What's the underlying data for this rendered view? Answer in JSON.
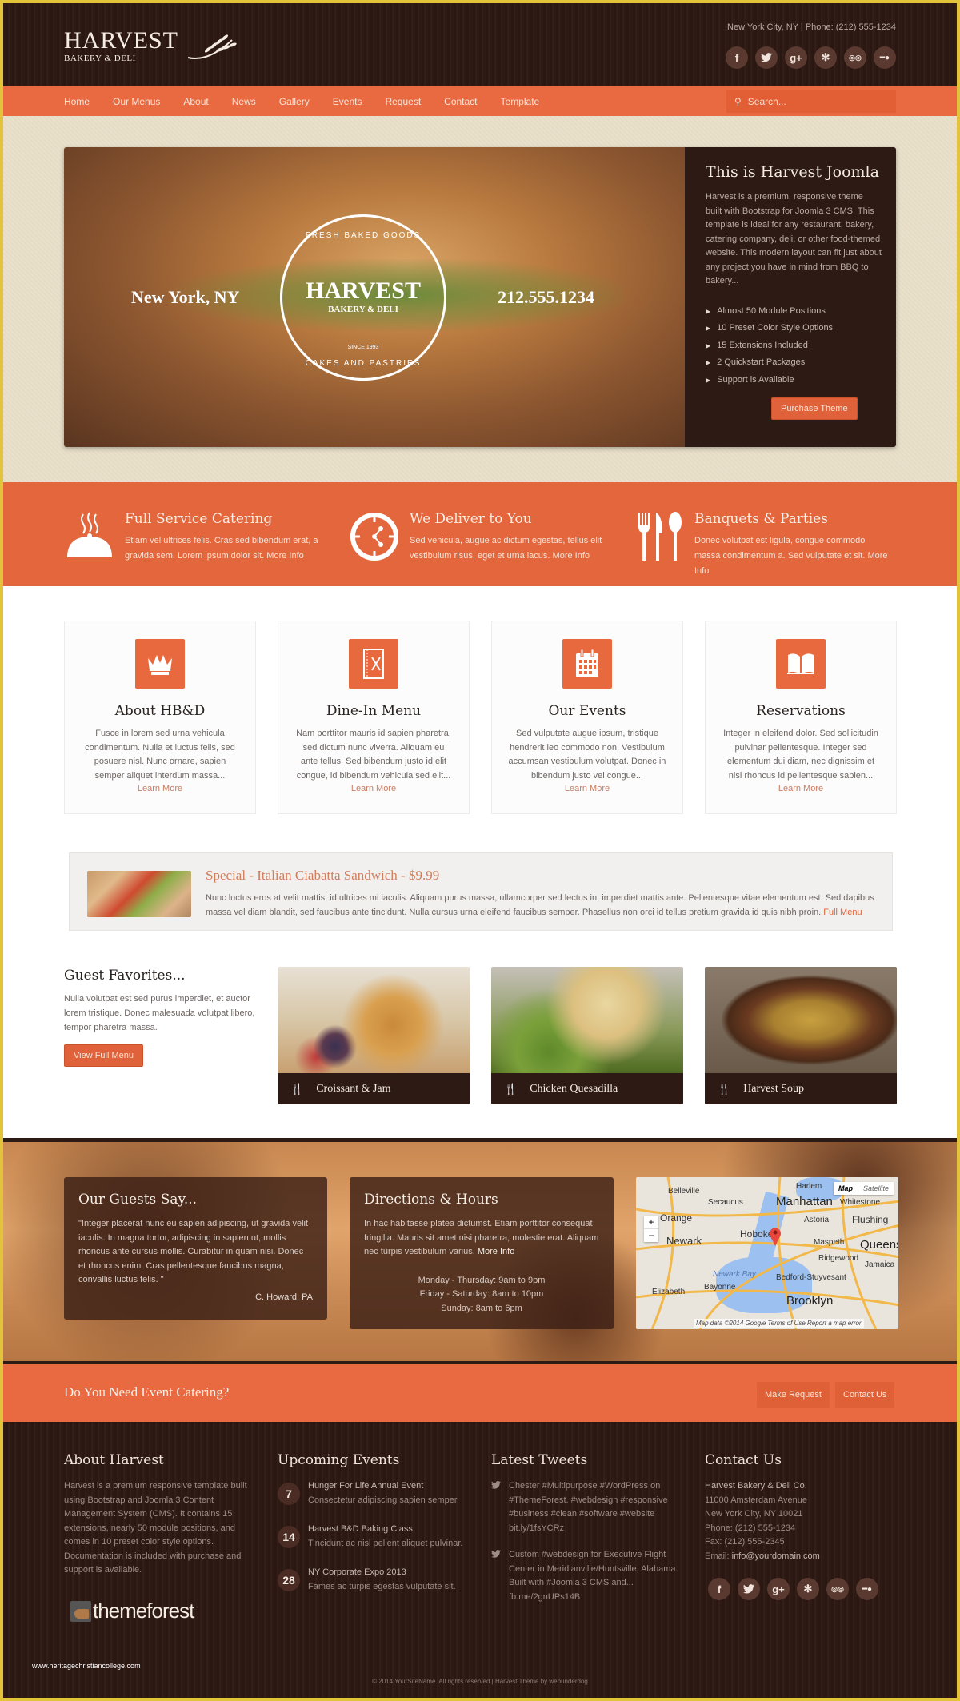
{
  "header": {
    "logo_main": "HARVEST",
    "logo_sub": "BAKERY & DELI",
    "top_info": "New York City, NY  |  Phone: (212) 555-1234",
    "socials": [
      {
        "name": "facebook-icon",
        "glyph": "f"
      },
      {
        "name": "twitter-icon",
        "glyph": "🐦"
      },
      {
        "name": "google-plus-icon",
        "glyph": "g+"
      },
      {
        "name": "yelp-icon",
        "glyph": "✻"
      },
      {
        "name": "tripadvisor-icon",
        "glyph": "◎◎"
      },
      {
        "name": "urbanspoon-icon",
        "glyph": "━●"
      }
    ]
  },
  "nav": {
    "items": [
      "Home",
      "Our Menus",
      "About",
      "News",
      "Gallery",
      "Events",
      "Request",
      "Contact",
      "Template"
    ],
    "search_placeholder": "Search..."
  },
  "hero": {
    "location": "New York, NY",
    "phone": "212.555.1234",
    "badge": {
      "top": "FRESH BAKED GOODS",
      "name": "HARVEST",
      "sub": "BAKERY & DELI",
      "since": "SINCE 1993",
      "bottom": "CAKES AND PASTRIES"
    },
    "panel": {
      "title": "This is Harvest Joomla",
      "body": "Harvest is a premium, responsive theme built with Bootstrap for Joomla 3 CMS. This template is ideal for any restaurant, bakery, catering company, deli, or other food-themed website. This modern layout can fit just about any project you have in mind from BBQ to bakery...",
      "features": [
        "Almost 50 Module Positions",
        "10 Preset Color Style Options",
        "15 Extensions Included",
        "2 Quickstart Packages",
        "Support is Available"
      ],
      "button": "Purchase Theme"
    }
  },
  "services": [
    {
      "title": "Full Service Catering",
      "text": "Etiam vel ultrices felis. Cras sed bibendum erat, a gravida sem. Lorem ipsum dolor sit.",
      "link": "More Info",
      "icon": "cloche-icon"
    },
    {
      "title": "We Deliver to You",
      "text": "Sed vehicula, augue ac dictum egestas, tellus elit vestibulum risus, eget et urna lacus.",
      "link": "More Info",
      "icon": "clock-icon"
    },
    {
      "title": "Banquets & Parties",
      "text": "Donec volutpat est ligula, congue commodo massa condimentum a. Sed vulputate et sit.",
      "link": "More Info",
      "icon": "cutlery-icon"
    }
  ],
  "cards": [
    {
      "title": "About HB&D",
      "text": "Fusce in lorem sed urna vehicula condimentum. Nulla et luctus felis, sed posuere nisl. Nunc ornare, sapien semper aliquet interdum massa...",
      "link": "Learn More",
      "icon": "crown-icon"
    },
    {
      "title": "Dine-In Menu",
      "text": "Nam porttitor mauris id sapien pharetra, sed dictum nunc viverra. Aliquam eu ante tellus. Sed bibendum justo id elit congue, id bibendum vehicula sed elit...",
      "link": "Learn More",
      "icon": "menu-book-icon"
    },
    {
      "title": "Our Events",
      "text": "Sed vulputate augue ipsum, tristique hendrerit leo commodo non. Vestibulum accumsan vestibulum volutpat. Donec in bibendum justo vel congue...",
      "link": "Learn More",
      "icon": "calendar-icon"
    },
    {
      "title": "Reservations",
      "text": "Integer in eleifend dolor. Sed sollicitudin pulvinar pellentesque. Integer sed elementum dui diam, nec dignissim et nisl rhoncus id pellentesque sapien...",
      "link": "Learn More",
      "icon": "open-book-icon"
    }
  ],
  "special": {
    "title": "Special - Italian Ciabatta Sandwich - $9.99",
    "text": "Nunc luctus eros at velit mattis, id ultrices mi iaculis. Aliquam purus massa, ullamcorper sed lectus in, imperdiet mattis ante. Pellentesque vitae elementum est. Sed dapibus massa vel diam blandit, sed faucibus ante tincidunt. Nulla cursus urna eleifend faucibus semper. Phasellus non orci id tellus pretium gravida id quis nibh proin.",
    "link": "Full Menu"
  },
  "favorites": {
    "title": "Guest Favorites...",
    "text": "Nulla volutpat est sed purus imperdiet, et auctor lorem tristique. Donec malesuada volutpat libero, tempor pharetra massa.",
    "button": "View Full Menu",
    "items": [
      "Croissant & Jam",
      "Chicken Quesadilla",
      "Harvest Soup"
    ]
  },
  "testimonial": {
    "title": "Our Guests Say...",
    "quote": "\"Integer placerat nunc eu sapien adipiscing, ut gravida velit iaculis. In magna tortor, adipiscing in sapien ut, mollis rhoncus ante cursus mollis. Curabitur in quam nisi. Donec et rhoncus enim. Cras pellentesque faucibus magna, convallis luctus felis. \"",
    "author": "C. Howard, PA"
  },
  "directions": {
    "title": "Directions & Hours",
    "text": "In hac habitasse platea dictumst. Etiam porttitor consequat fringilla. Mauris sit amet nisi pharetra, molestie erat. Aliquam nec turpis vestibulum varius.",
    "link": "More Info",
    "hours": [
      "Monday - Thursday: 9am to 9pm",
      "Friday - Saturday: 8am to 10pm",
      "Sunday: 8am to 6pm"
    ]
  },
  "map": {
    "toggle": [
      "Map",
      "Satellite"
    ],
    "labels": [
      "Belleville",
      "Secaucus",
      "Manhattan",
      "Harlem",
      "Whitestone",
      "Orange",
      "Astoria",
      "Flushing",
      "Newark",
      "Hoboken",
      "Maspeth",
      "Queens",
      "Ridgewood",
      "Jamaica",
      "Newark Bay",
      "Bedford-Stuyvesant",
      "Elizabeth",
      "Bayonne",
      "Brooklyn"
    ],
    "footer": "Map data ©2014 Google   Terms of Use   Report a map error"
  },
  "catering": {
    "title": "Do You Need Event Catering?",
    "buttons": [
      "Make Request",
      "Contact Us"
    ]
  },
  "footer": {
    "about": {
      "title": "About Harvest",
      "text": "Harvest is a premium responsive template built using Bootstrap and Joomla 3 Content Management System (CMS). It contains 15 extensions, nearly 50 module positions, and comes in 10 preset color style options. Documentation is included with purchase and support is available.",
      "brand": "themeforest"
    },
    "events": {
      "title": "Upcoming Events",
      "items": [
        {
          "day": "7",
          "title": "Hunger For Life Annual Event",
          "sub": "Consectetur adipiscing sapien semper."
        },
        {
          "day": "14",
          "title": "Harvest B&D Baking Class",
          "sub": "Tincidunt ac nisl pellent aliquet pulvinar."
        },
        {
          "day": "28",
          "title": "NY Corporate Expo 2013",
          "sub": "Fames ac turpis egestas vulputate sit."
        }
      ]
    },
    "tweets": {
      "title": "Latest Tweets",
      "items": [
        "Chester #Multipurpose #WordPress on #ThemeForest. #webdesign #responsive #business #clean #software #website bit.ly/1fsYCRz",
        "Custom #webdesign for Executive Flight Center in Meridianville/Huntsville, Alabama. Built with #Joomla 3 CMS and... fb.me/2gnUPs14B"
      ]
    },
    "contact": {
      "title": "Contact Us",
      "company": "Harvest Bakery & Deli Co.",
      "address1": "11000 Amsterdam Avenue",
      "address2": "New York City, NY 10021",
      "phone": "Phone: (212) 555-1234",
      "fax": "Fax: (212) 555-2345",
      "email_label": "Email: ",
      "email": "info@yourdomain.com"
    },
    "copyright": "© 2014 YourSiteName. All rights reserved | Harvest Theme by webunderdog",
    "watermark": "www.heritagechristiancollege.com"
  }
}
